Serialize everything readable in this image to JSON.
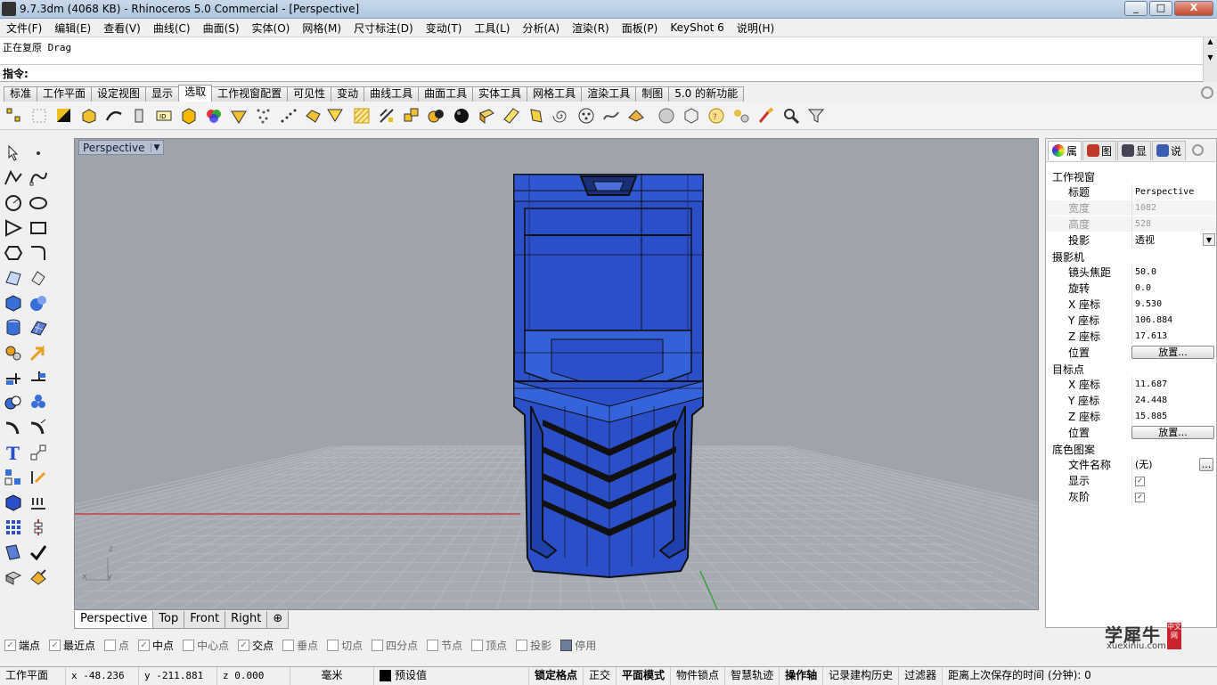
{
  "window": {
    "title": "9.7.3dm (4068 KB) - Rhinoceros 5.0 Commercial - [Perspective]",
    "buttons": [
      "_",
      "□",
      "X"
    ]
  },
  "menu": [
    "文件(F)",
    "编辑(E)",
    "查看(V)",
    "曲线(C)",
    "曲面(S)",
    "实体(O)",
    "网格(M)",
    "尺寸标注(D)",
    "变动(T)",
    "工具(L)",
    "分析(A)",
    "渲染(R)",
    "面板(P)",
    "KeyShot 6",
    "说明(H)"
  ],
  "command": {
    "history": "正在复原 Drag",
    "prompt": "指令:"
  },
  "toolbar_tabs": [
    "标准",
    "工作平面",
    "设定视图",
    "显示",
    "选取",
    "工作视窗配置",
    "可见性",
    "变动",
    "曲线工具",
    "曲面工具",
    "实体工具",
    "网格工具",
    "渲染工具",
    "制图",
    "5.0 的新功能"
  ],
  "active_toolbar_tab": "选取",
  "viewport": {
    "label": "Perspective",
    "dropdown": "▼",
    "axis": {
      "z": "z",
      "x": "x",
      "y": "y"
    }
  },
  "viewport_tabs": [
    "Perspective",
    "Top",
    "Front",
    "Right",
    "⊕"
  ],
  "panel": {
    "tabs": [
      "属",
      "图",
      "显",
      "说"
    ],
    "sections": {
      "viewport": "工作视窗",
      "camera": "摄影机",
      "target": "目标点",
      "wallpaper": "底色图案"
    },
    "viewport_props": [
      {
        "k": "标题",
        "v": "Perspective"
      },
      {
        "k": "宽度",
        "v": "1082"
      },
      {
        "k": "高度",
        "v": "528"
      },
      {
        "k": "投影",
        "v": "透视"
      }
    ],
    "camera_props": [
      {
        "k": "镜头焦距",
        "v": "50.0"
      },
      {
        "k": "旋转",
        "v": "0.0"
      },
      {
        "k": "X 座标",
        "v": "9.530"
      },
      {
        "k": "Y 座标",
        "v": "106.884"
      },
      {
        "k": "Z 座标",
        "v": "17.613"
      },
      {
        "k": "位置",
        "v": "放置..."
      }
    ],
    "target_props": [
      {
        "k": "X 座标",
        "v": "11.687"
      },
      {
        "k": "Y 座标",
        "v": "24.448"
      },
      {
        "k": "Z 座标",
        "v": "15.885"
      },
      {
        "k": "位置",
        "v": "放置..."
      }
    ],
    "wallpaper_props": [
      {
        "k": "文件名称",
        "v": "(无)",
        "btn": "..."
      },
      {
        "k": "显示",
        "v": "✓"
      },
      {
        "k": "灰阶",
        "v": "✓"
      }
    ]
  },
  "osnap": [
    {
      "label": "端点",
      "checked": true
    },
    {
      "label": "最近点",
      "checked": true
    },
    {
      "label": "点",
      "checked": false
    },
    {
      "label": "中点",
      "checked": true
    },
    {
      "label": "中心点",
      "checked": false
    },
    {
      "label": "交点",
      "checked": true
    },
    {
      "label": "垂点",
      "checked": false
    },
    {
      "label": "切点",
      "checked": false
    },
    {
      "label": "四分点",
      "checked": false
    },
    {
      "label": "节点",
      "checked": false
    },
    {
      "label": "顶点",
      "checked": false
    },
    {
      "label": "投影",
      "checked": false
    },
    {
      "label": "停用",
      "checked": false
    }
  ],
  "status": {
    "cplane": "工作平面",
    "x": "x -48.236",
    "y": "y -211.881",
    "z": "z 0.000",
    "units": "毫米",
    "layer": "预设值",
    "grid_snap": "锁定格点",
    "ortho": "正交",
    "planar": "平面模式",
    "osnap": "物件锁点",
    "smarttrack": "智慧轨迹",
    "gumball": "操作轴",
    "history": "记录建构历史",
    "filter": "过滤器",
    "save_time": "距离上次保存的时间 (分钟): 0"
  },
  "watermark": {
    "text": "学犀牛",
    "url": "xuexiniu.com",
    "stamp": "中文网"
  },
  "colors": {
    "model_blue": "#2a4fc9",
    "viewport_bg": "#9ea3ac",
    "grid": "#b2b6bd",
    "x_axis": "#c44040",
    "y_axis": "#3aa03a"
  }
}
